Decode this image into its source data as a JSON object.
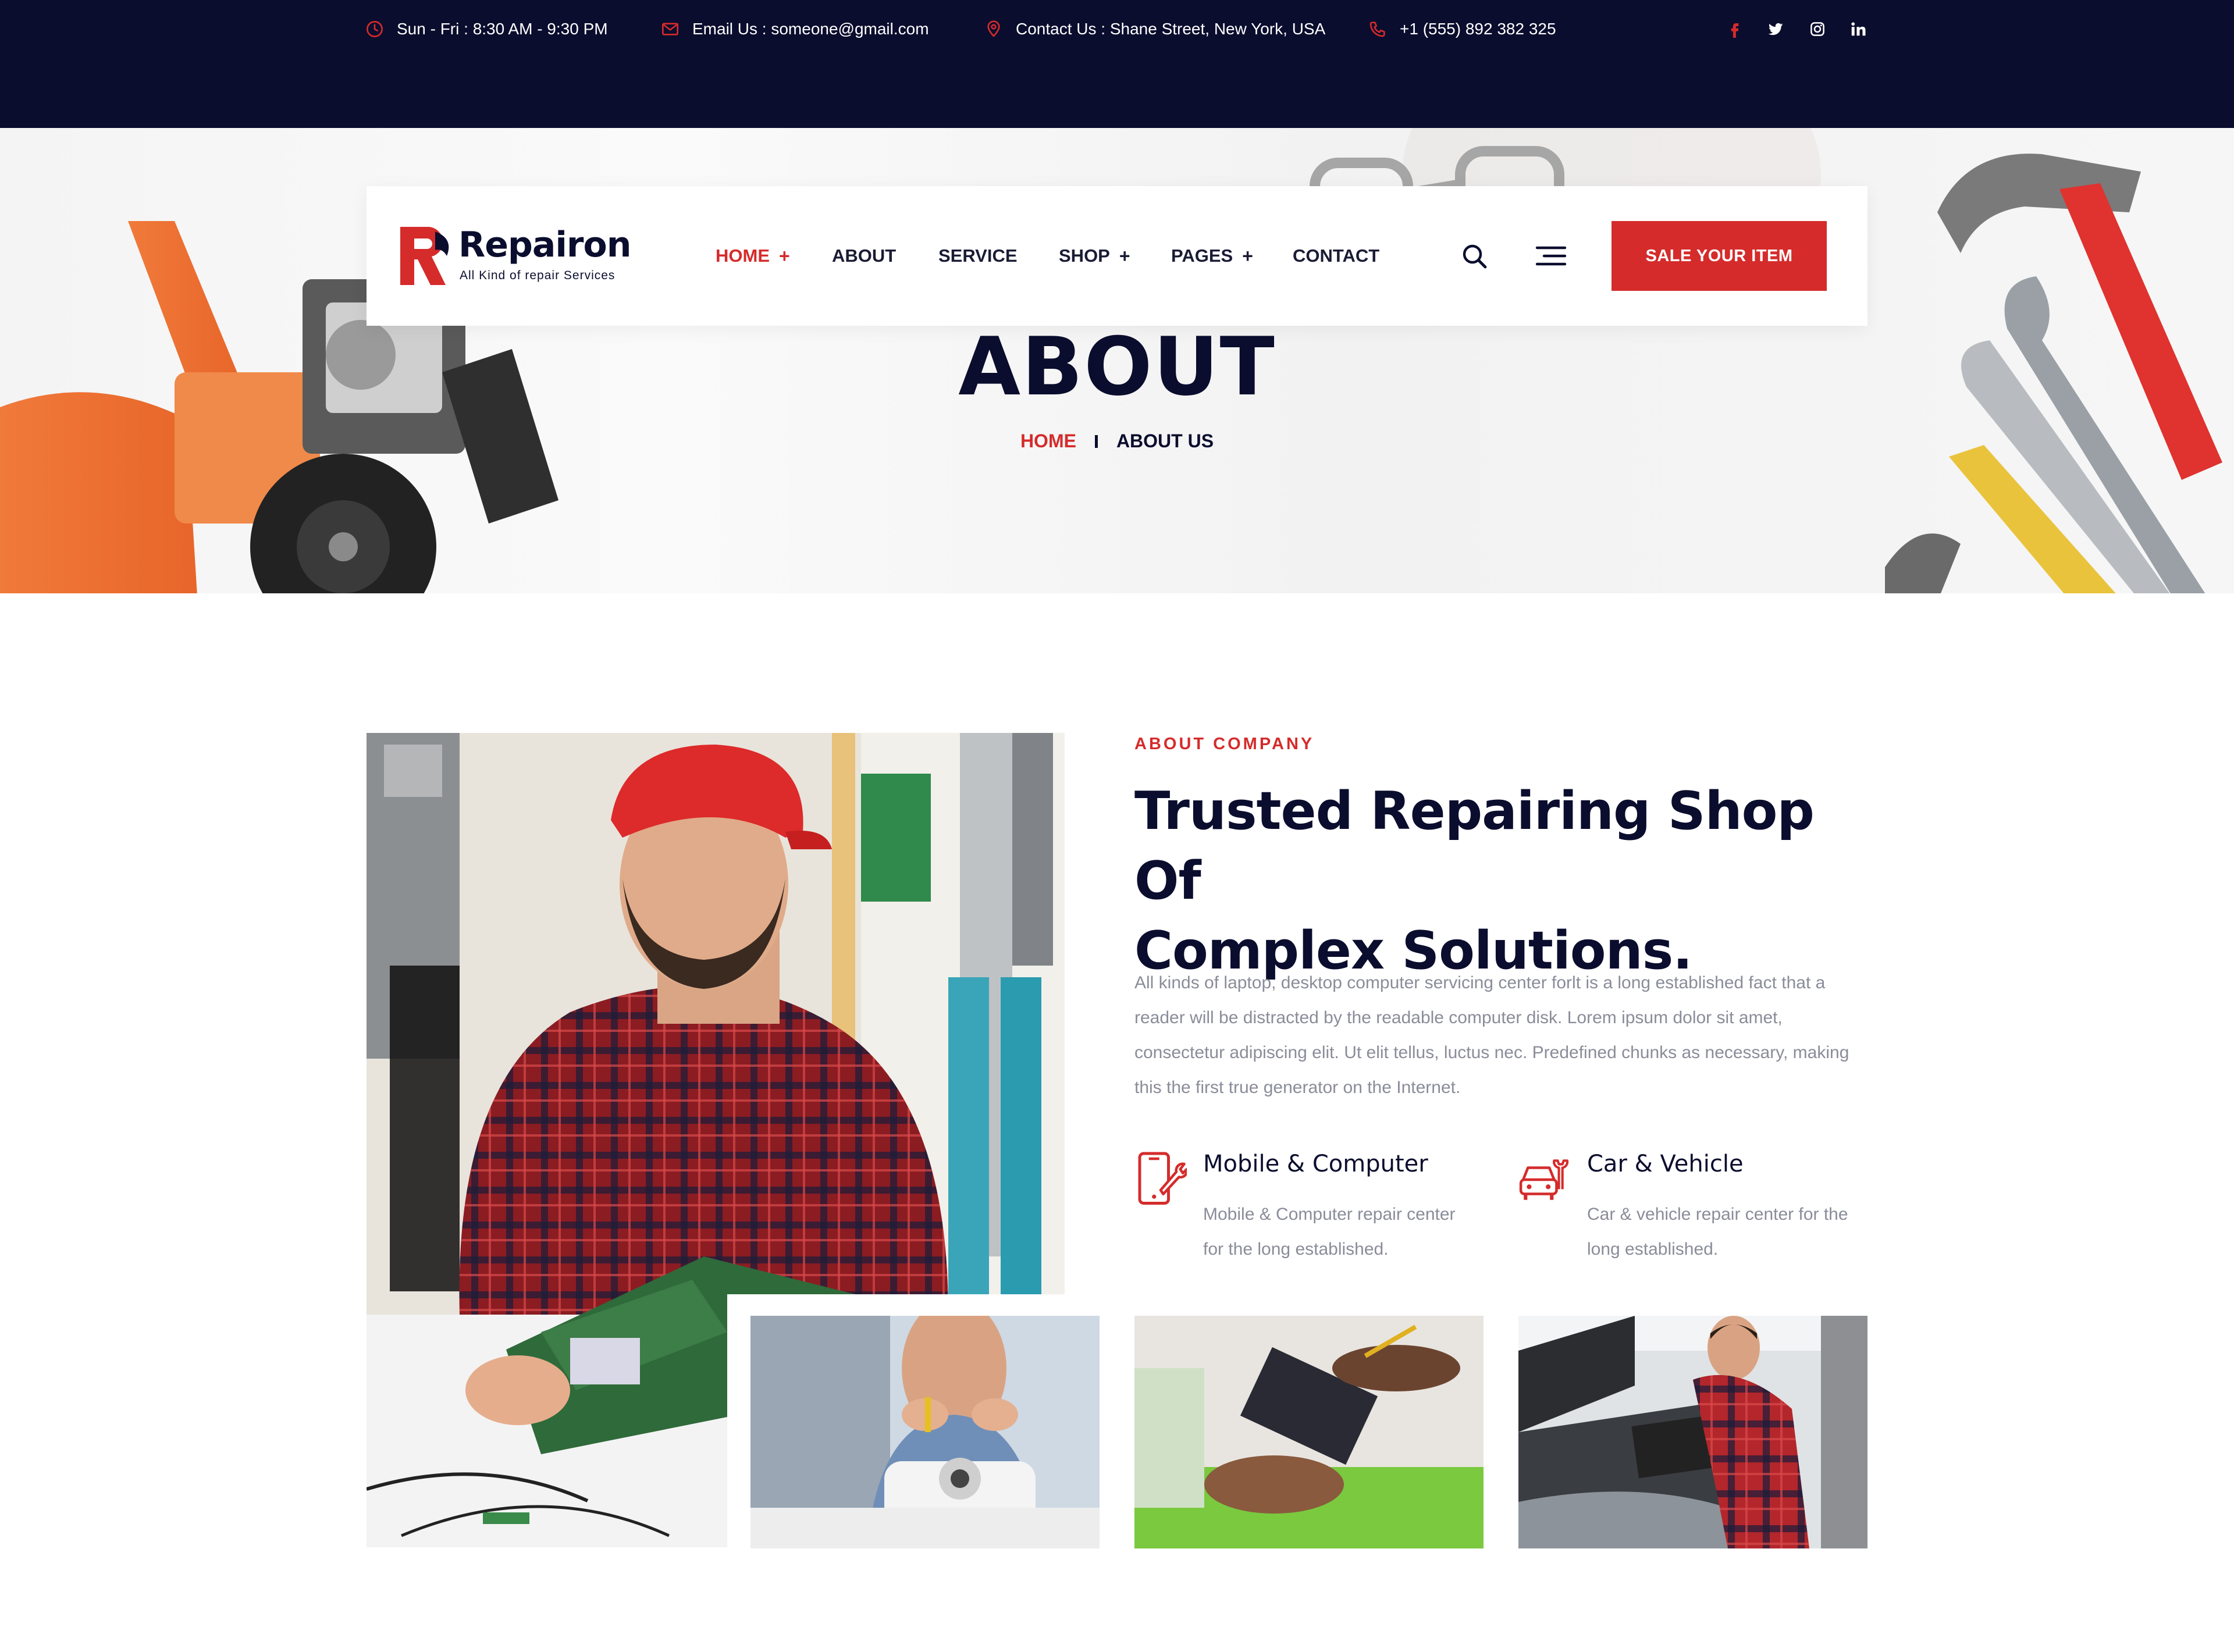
{
  "topbar": {
    "hours": "Sun - Fri : 8:30 AM - 9:30 PM",
    "email": "Email Us : someone@gmail.com",
    "address": "Contact Us : Shane Street, New York, USA",
    "phone": "+1 (555) 892 382 325",
    "social_icons": [
      "facebook-icon",
      "twitter-icon",
      "instagram-icon",
      "linkedin-icon"
    ]
  },
  "header": {
    "logo_name": "Repairon",
    "logo_tagline": "All Kind of repair Services",
    "nav": [
      {
        "label": "HOME",
        "plus": "+"
      },
      {
        "label": "ABOUT"
      },
      {
        "label": "SERVICE"
      },
      {
        "label": "SHOP",
        "plus": "+"
      },
      {
        "label": "PAGES",
        "plus": "+"
      },
      {
        "label": "CONTACT"
      }
    ],
    "cta_label": "SALE YOUR ITEM"
  },
  "hero": {
    "title": "ABOUT",
    "breadcrumb_home": "HOME",
    "breadcrumb_current": "ABOUT US"
  },
  "about": {
    "eyebrow": "ABOUT COMPANY",
    "heading_line1": "Trusted Repairing Shop Of",
    "heading_line2": "Complex Solutions.",
    "paragraph": "All kinds of laptop, desktop computer servicing center forlt is a long established fact that a reader will be distracted by the readable computer disk. Lorem ipsum dolor sit amet, consectetur adipiscing elit. Ut elit tellus, luctus nec. Predefined chunks as necessary, making this the first true generator on the Internet.",
    "features": [
      {
        "icon": "mobile-repair-icon",
        "title": "Mobile & Computer",
        "text": "Mobile & Computer repair center for the long established."
      },
      {
        "icon": "car-repair-icon",
        "title": "Car & Vehicle",
        "text": "Car & vehicle repair center for the long established."
      }
    ]
  },
  "colors": {
    "accent": "#d52b2b",
    "navy": "#0b0d2e",
    "muted_text": "#8a8c99"
  }
}
